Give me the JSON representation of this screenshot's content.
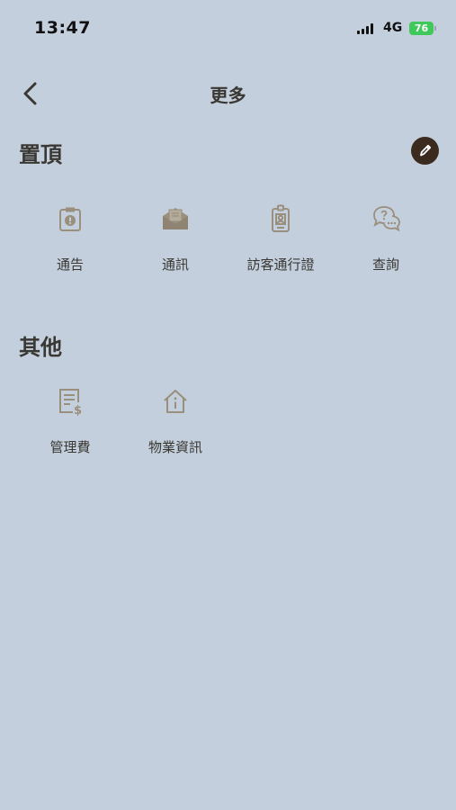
{
  "status_bar": {
    "time": "13:47",
    "network": "4G",
    "battery": "76"
  },
  "nav": {
    "title": "更多",
    "back_icon": "chevron-left-icon"
  },
  "pinned": {
    "title": "置頂",
    "edit_icon": "pencil-icon",
    "items": [
      {
        "label": "通告",
        "icon": "clipboard-alert-icon"
      },
      {
        "label": "通訊",
        "icon": "mail-open-icon"
      },
      {
        "label": "訪客通行證",
        "icon": "badge-id-icon"
      },
      {
        "label": "查詢",
        "icon": "chat-question-icon"
      }
    ]
  },
  "others": {
    "title": "其他",
    "items": [
      {
        "label": "管理費",
        "icon": "receipt-dollar-icon"
      },
      {
        "label": "物業資訊",
        "icon": "house-info-icon"
      }
    ]
  },
  "colors": {
    "background": "#c3cfdc",
    "icon": "#9a8e7c",
    "text": "#3a3833",
    "edit_button": "#3b2a1e",
    "battery": "#3fc95a"
  }
}
